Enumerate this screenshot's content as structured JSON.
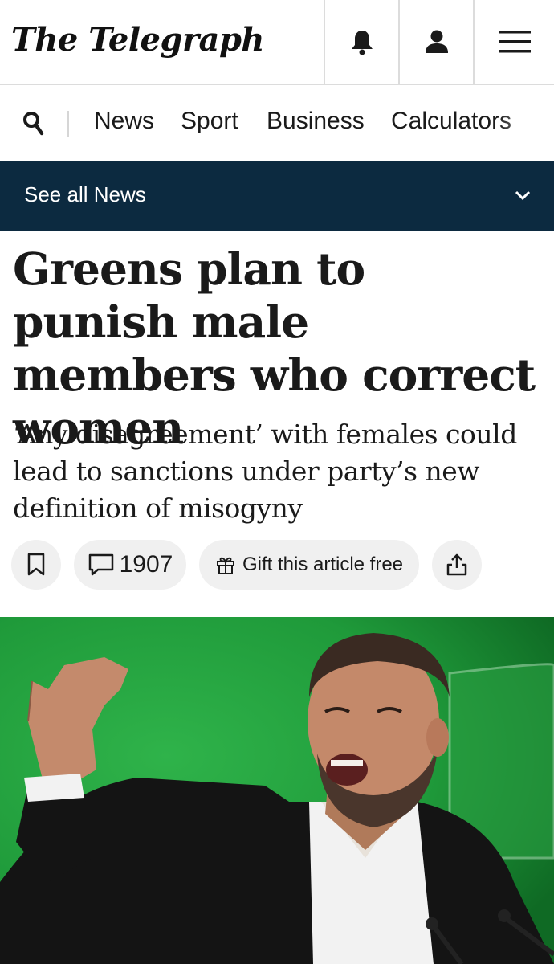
{
  "header": {
    "logo_text": "The Telegraph",
    "bell_icon": "bell-icon",
    "user_icon": "user-icon",
    "menu_icon": "hamburger-menu-icon"
  },
  "nav": {
    "search_icon": "search-icon",
    "items": [
      "News",
      "Sport",
      "Business",
      "Calculators"
    ]
  },
  "section_bar": {
    "label": "See all News",
    "chevron_icon": "chevron-down-icon",
    "background": "#0c2a40"
  },
  "article": {
    "headline": "Greens plan to punish male members who correct women",
    "standfirst": "‘Any disagreement’ with females could lead to sanctions under party’s new definition of misogyny"
  },
  "actions": {
    "bookmark_icon": "bookmark-icon",
    "comment_count": "1907",
    "comment_icon": "comment-icon",
    "gift_label": "Gift this article free",
    "gift_icon": "gift-icon",
    "share_icon": "share-icon"
  },
  "photo": {
    "description_icon": "article-hero-photo",
    "background": "#1f9a3a"
  }
}
